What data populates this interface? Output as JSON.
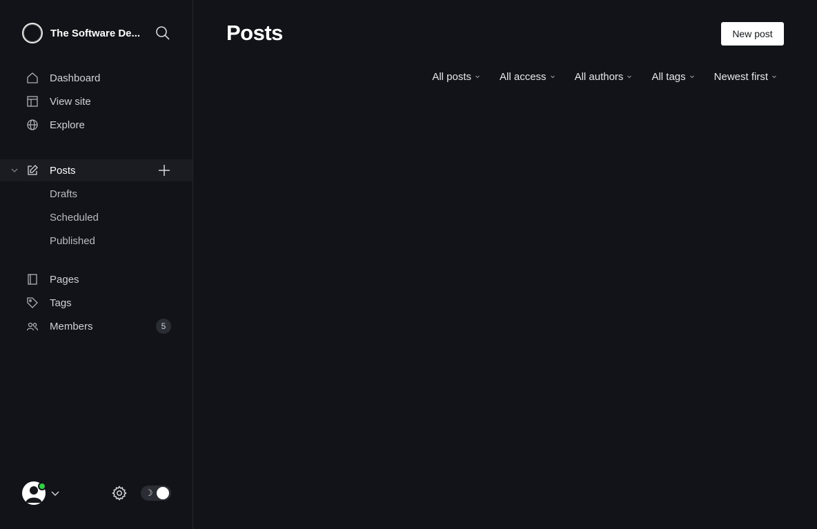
{
  "site": {
    "name": "The Software De..."
  },
  "nav": {
    "primary": [
      {
        "label": "Dashboard",
        "icon": "home-icon"
      },
      {
        "label": "View site",
        "icon": "layout-icon"
      },
      {
        "label": "Explore",
        "icon": "globe-icon"
      }
    ],
    "posts": {
      "label": "Posts",
      "sub": [
        "Drafts",
        "Scheduled",
        "Published"
      ]
    },
    "secondary": [
      {
        "label": "Pages",
        "icon": "page-icon"
      },
      {
        "label": "Tags",
        "icon": "tag-icon"
      },
      {
        "label": "Members",
        "icon": "members-icon",
        "badge": "5"
      }
    ]
  },
  "main": {
    "title": "Posts",
    "new_post_label": "New post",
    "filters": [
      "All posts",
      "All access",
      "All authors",
      "All tags",
      "Newest first"
    ]
  },
  "footer": {
    "theme_toggle_glyph": "☽"
  },
  "colors": {
    "background": "#121318",
    "accent_online": "#30cf43",
    "button_bg": "#ffffff"
  }
}
